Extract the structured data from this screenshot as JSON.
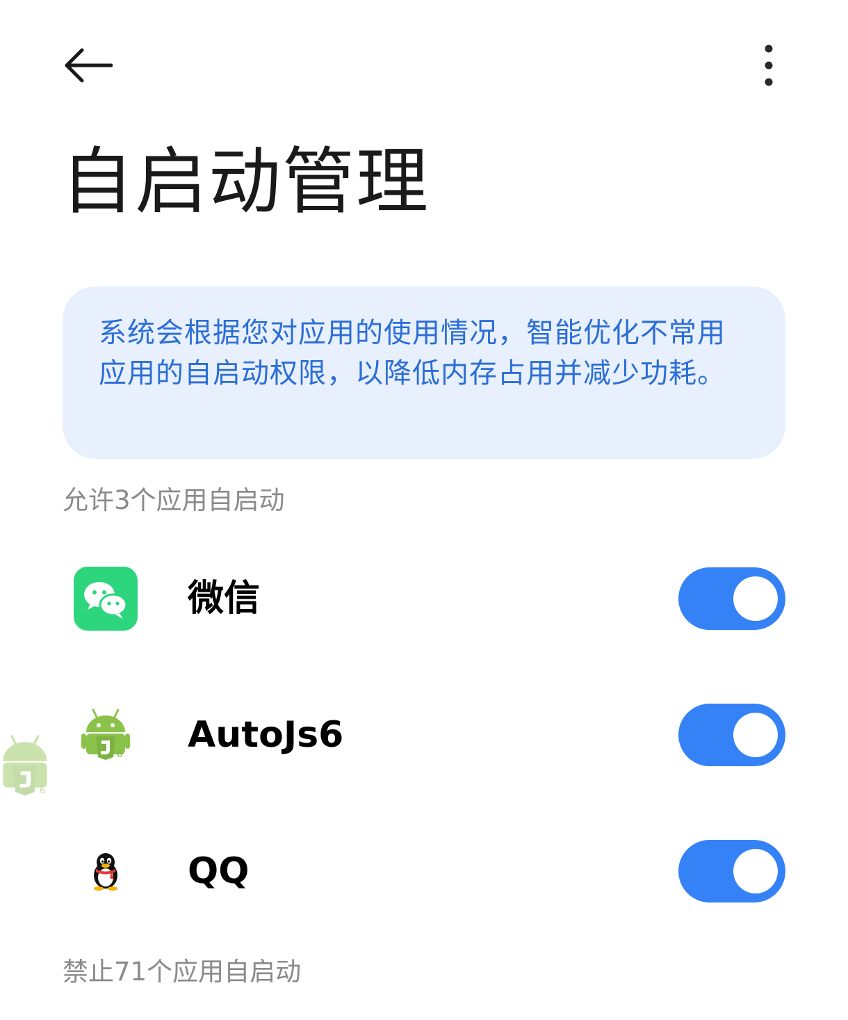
{
  "header": {
    "back_icon": "arrow-left-icon",
    "more_icon": "more-vertical-icon"
  },
  "page": {
    "title": "自启动管理"
  },
  "info_card": {
    "text": "系统会根据您对应用的使用情况，智能优化不常用应用的自启动权限，以降低内存占用并减少功耗。"
  },
  "sections": {
    "allowed_header": "允许3个应用自启动",
    "blocked_header": "禁止71个应用自启动"
  },
  "apps": [
    {
      "name": "微信",
      "icon": "wechat-icon",
      "enabled": true
    },
    {
      "name": "AutoJs6",
      "icon": "autojs6-icon",
      "enabled": true
    },
    {
      "name": "QQ",
      "icon": "qq-penguin-icon",
      "enabled": true
    }
  ],
  "colors": {
    "accent": "#3582f7",
    "info_text": "#2b6ed6",
    "info_bg": "#e8f0fd",
    "section_header": "#8a8a8a",
    "wechat_green": "#2dd57c",
    "android_green": "#8bc34a"
  }
}
